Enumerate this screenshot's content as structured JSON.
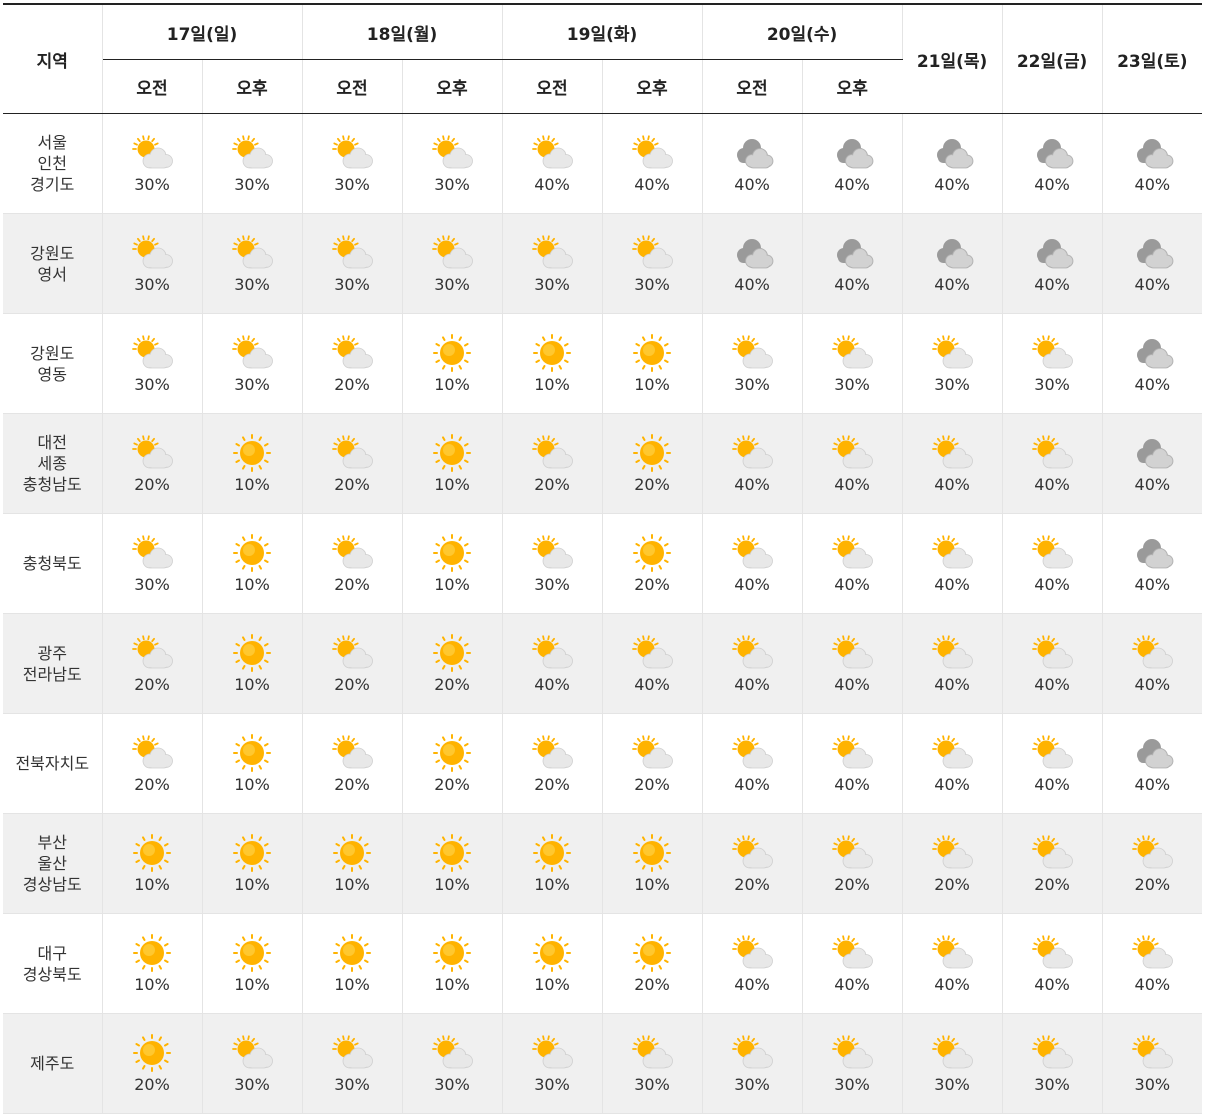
{
  "header": {
    "region_label": "지역",
    "am_label": "오전",
    "pm_label": "오후",
    "split_days": [
      "17일(일)",
      "18일(월)",
      "19일(화)",
      "20일(수)"
    ],
    "full_days": [
      "21일(목)",
      "22일(금)",
      "23일(토)"
    ]
  },
  "icon_legend": {
    "sun": "sunny-icon",
    "partly": "partly-cloudy-icon",
    "cloudy": "cloudy-icon"
  },
  "colors": {
    "sun": "#ffb300",
    "cloud_light": "#e8e8e8",
    "cloud_dark": "#9a9a9a"
  },
  "rows": [
    {
      "region": [
        "서울",
        "인천",
        "경기도"
      ],
      "cells": [
        {
          "icon": "partly",
          "pct": "30%"
        },
        {
          "icon": "partly",
          "pct": "30%"
        },
        {
          "icon": "partly",
          "pct": "30%"
        },
        {
          "icon": "partly",
          "pct": "30%"
        },
        {
          "icon": "partly",
          "pct": "40%"
        },
        {
          "icon": "partly",
          "pct": "40%"
        },
        {
          "icon": "cloudy",
          "pct": "40%"
        },
        {
          "icon": "cloudy",
          "pct": "40%"
        },
        {
          "icon": "cloudy",
          "pct": "40%"
        },
        {
          "icon": "cloudy",
          "pct": "40%"
        },
        {
          "icon": "cloudy",
          "pct": "40%"
        }
      ]
    },
    {
      "region": [
        "강원도",
        "영서"
      ],
      "cells": [
        {
          "icon": "partly",
          "pct": "30%"
        },
        {
          "icon": "partly",
          "pct": "30%"
        },
        {
          "icon": "partly",
          "pct": "30%"
        },
        {
          "icon": "partly",
          "pct": "30%"
        },
        {
          "icon": "partly",
          "pct": "30%"
        },
        {
          "icon": "partly",
          "pct": "30%"
        },
        {
          "icon": "cloudy",
          "pct": "40%"
        },
        {
          "icon": "cloudy",
          "pct": "40%"
        },
        {
          "icon": "cloudy",
          "pct": "40%"
        },
        {
          "icon": "cloudy",
          "pct": "40%"
        },
        {
          "icon": "cloudy",
          "pct": "40%"
        }
      ]
    },
    {
      "region": [
        "강원도",
        "영동"
      ],
      "cells": [
        {
          "icon": "partly",
          "pct": "30%"
        },
        {
          "icon": "partly",
          "pct": "30%"
        },
        {
          "icon": "partly",
          "pct": "20%"
        },
        {
          "icon": "sun",
          "pct": "10%"
        },
        {
          "icon": "sun",
          "pct": "10%"
        },
        {
          "icon": "sun",
          "pct": "10%"
        },
        {
          "icon": "partly",
          "pct": "30%"
        },
        {
          "icon": "partly",
          "pct": "30%"
        },
        {
          "icon": "partly",
          "pct": "30%"
        },
        {
          "icon": "partly",
          "pct": "30%"
        },
        {
          "icon": "cloudy",
          "pct": "40%"
        }
      ]
    },
    {
      "region": [
        "대전",
        "세종",
        "충청남도"
      ],
      "cells": [
        {
          "icon": "partly",
          "pct": "20%"
        },
        {
          "icon": "sun",
          "pct": "10%"
        },
        {
          "icon": "partly",
          "pct": "20%"
        },
        {
          "icon": "sun",
          "pct": "10%"
        },
        {
          "icon": "partly",
          "pct": "20%"
        },
        {
          "icon": "sun",
          "pct": "20%"
        },
        {
          "icon": "partly",
          "pct": "40%"
        },
        {
          "icon": "partly",
          "pct": "40%"
        },
        {
          "icon": "partly",
          "pct": "40%"
        },
        {
          "icon": "partly",
          "pct": "40%"
        },
        {
          "icon": "cloudy",
          "pct": "40%"
        }
      ]
    },
    {
      "region": [
        "충청북도"
      ],
      "cells": [
        {
          "icon": "partly",
          "pct": "30%"
        },
        {
          "icon": "sun",
          "pct": "10%"
        },
        {
          "icon": "partly",
          "pct": "20%"
        },
        {
          "icon": "sun",
          "pct": "10%"
        },
        {
          "icon": "partly",
          "pct": "30%"
        },
        {
          "icon": "sun",
          "pct": "20%"
        },
        {
          "icon": "partly",
          "pct": "40%"
        },
        {
          "icon": "partly",
          "pct": "40%"
        },
        {
          "icon": "partly",
          "pct": "40%"
        },
        {
          "icon": "partly",
          "pct": "40%"
        },
        {
          "icon": "cloudy",
          "pct": "40%"
        }
      ]
    },
    {
      "region": [
        "광주",
        "전라남도"
      ],
      "cells": [
        {
          "icon": "partly",
          "pct": "20%"
        },
        {
          "icon": "sun",
          "pct": "10%"
        },
        {
          "icon": "partly",
          "pct": "20%"
        },
        {
          "icon": "sun",
          "pct": "20%"
        },
        {
          "icon": "partly",
          "pct": "40%"
        },
        {
          "icon": "partly",
          "pct": "40%"
        },
        {
          "icon": "partly",
          "pct": "40%"
        },
        {
          "icon": "partly",
          "pct": "40%"
        },
        {
          "icon": "partly",
          "pct": "40%"
        },
        {
          "icon": "partly",
          "pct": "40%"
        },
        {
          "icon": "partly",
          "pct": "40%"
        }
      ]
    },
    {
      "region": [
        "전북자치도"
      ],
      "cells": [
        {
          "icon": "partly",
          "pct": "20%"
        },
        {
          "icon": "sun",
          "pct": "10%"
        },
        {
          "icon": "partly",
          "pct": "20%"
        },
        {
          "icon": "sun",
          "pct": "20%"
        },
        {
          "icon": "partly",
          "pct": "20%"
        },
        {
          "icon": "partly",
          "pct": "20%"
        },
        {
          "icon": "partly",
          "pct": "40%"
        },
        {
          "icon": "partly",
          "pct": "40%"
        },
        {
          "icon": "partly",
          "pct": "40%"
        },
        {
          "icon": "partly",
          "pct": "40%"
        },
        {
          "icon": "cloudy",
          "pct": "40%"
        }
      ]
    },
    {
      "region": [
        "부산",
        "울산",
        "경상남도"
      ],
      "cells": [
        {
          "icon": "sun",
          "pct": "10%"
        },
        {
          "icon": "sun",
          "pct": "10%"
        },
        {
          "icon": "sun",
          "pct": "10%"
        },
        {
          "icon": "sun",
          "pct": "10%"
        },
        {
          "icon": "sun",
          "pct": "10%"
        },
        {
          "icon": "sun",
          "pct": "10%"
        },
        {
          "icon": "partly",
          "pct": "20%"
        },
        {
          "icon": "partly",
          "pct": "20%"
        },
        {
          "icon": "partly",
          "pct": "20%"
        },
        {
          "icon": "partly",
          "pct": "20%"
        },
        {
          "icon": "partly",
          "pct": "20%"
        }
      ]
    },
    {
      "region": [
        "대구",
        "경상북도"
      ],
      "cells": [
        {
          "icon": "sun",
          "pct": "10%"
        },
        {
          "icon": "sun",
          "pct": "10%"
        },
        {
          "icon": "sun",
          "pct": "10%"
        },
        {
          "icon": "sun",
          "pct": "10%"
        },
        {
          "icon": "sun",
          "pct": "10%"
        },
        {
          "icon": "sun",
          "pct": "20%"
        },
        {
          "icon": "partly",
          "pct": "40%"
        },
        {
          "icon": "partly",
          "pct": "40%"
        },
        {
          "icon": "partly",
          "pct": "40%"
        },
        {
          "icon": "partly",
          "pct": "40%"
        },
        {
          "icon": "partly",
          "pct": "40%"
        }
      ]
    },
    {
      "region": [
        "제주도"
      ],
      "cells": [
        {
          "icon": "sun",
          "pct": "20%"
        },
        {
          "icon": "partly",
          "pct": "30%"
        },
        {
          "icon": "partly",
          "pct": "30%"
        },
        {
          "icon": "partly",
          "pct": "30%"
        },
        {
          "icon": "partly",
          "pct": "30%"
        },
        {
          "icon": "partly",
          "pct": "30%"
        },
        {
          "icon": "partly",
          "pct": "30%"
        },
        {
          "icon": "partly",
          "pct": "30%"
        },
        {
          "icon": "partly",
          "pct": "30%"
        },
        {
          "icon": "partly",
          "pct": "30%"
        },
        {
          "icon": "partly",
          "pct": "30%"
        }
      ]
    }
  ]
}
